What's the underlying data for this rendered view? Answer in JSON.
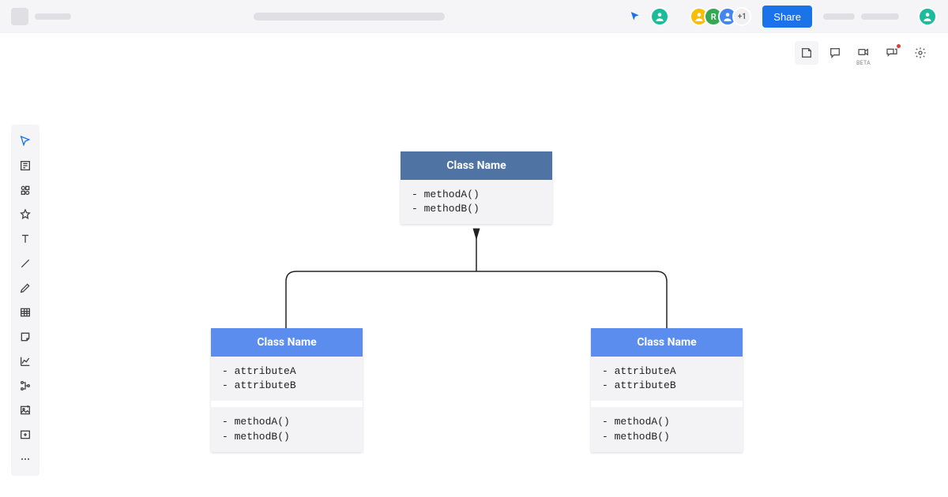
{
  "topbar": {
    "share_label": "Share",
    "avatars_extra": "+1"
  },
  "right_tools": {
    "beta_label": "BETA"
  },
  "diagram": {
    "parent": {
      "title": "Class Name",
      "methods": "- methodA()\n- methodB()"
    },
    "child_left": {
      "title": "Class Name",
      "attributes": "- attributeA\n- attributeB",
      "methods": "- methodA()\n- methodB()"
    },
    "child_right": {
      "title": "Class Name",
      "attributes": "- attributeA\n- attributeB",
      "methods": "- methodA()\n- methodB()"
    }
  }
}
